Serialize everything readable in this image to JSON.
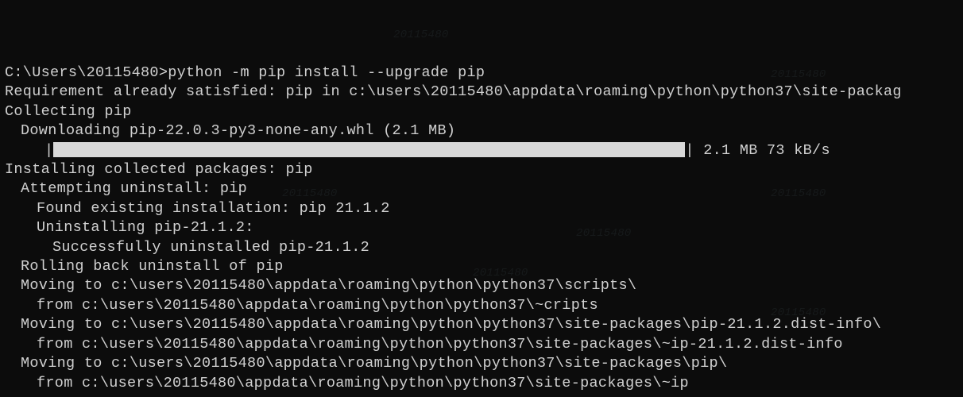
{
  "prompt": "C:\\Users\\20115480>",
  "command": "python -m pip install --upgrade pip",
  "lines": {
    "l1": "Requirement already satisfied: pip in c:\\users\\20115480\\appdata\\roaming\\python\\python37\\site-packag",
    "l2": "Collecting pip",
    "l3": "Downloading pip-22.0.3-py3-none-any.whl (2.1 MB)",
    "progress_stats": "2.1 MB 73 kB/s",
    "l4": "Installing collected packages: pip",
    "l5": "Attempting uninstall: pip",
    "l6": "Found existing installation: pip 21.1.2",
    "l7": "Uninstalling pip-21.1.2:",
    "l8": "Successfully uninstalled pip-21.1.2",
    "l9": "Rolling back uninstall of pip",
    "l10": "Moving to c:\\users\\20115480\\appdata\\roaming\\python\\python37\\scripts\\",
    "l11": " from c:\\users\\20115480\\appdata\\roaming\\python\\python37\\~cripts",
    "l12": "Moving to c:\\users\\20115480\\appdata\\roaming\\python\\python37\\site-packages\\pip-21.1.2.dist-info\\",
    "l13": " from c:\\users\\20115480\\appdata\\roaming\\python\\python37\\site-packages\\~ip-21.1.2.dist-info",
    "l14": "Moving to c:\\users\\20115480\\appdata\\roaming\\python\\python37\\site-packages\\pip\\",
    "l15": " from c:\\users\\20115480\\appdata\\roaming\\python\\python37\\site-packages\\~ip"
  },
  "watermark": "20115480"
}
